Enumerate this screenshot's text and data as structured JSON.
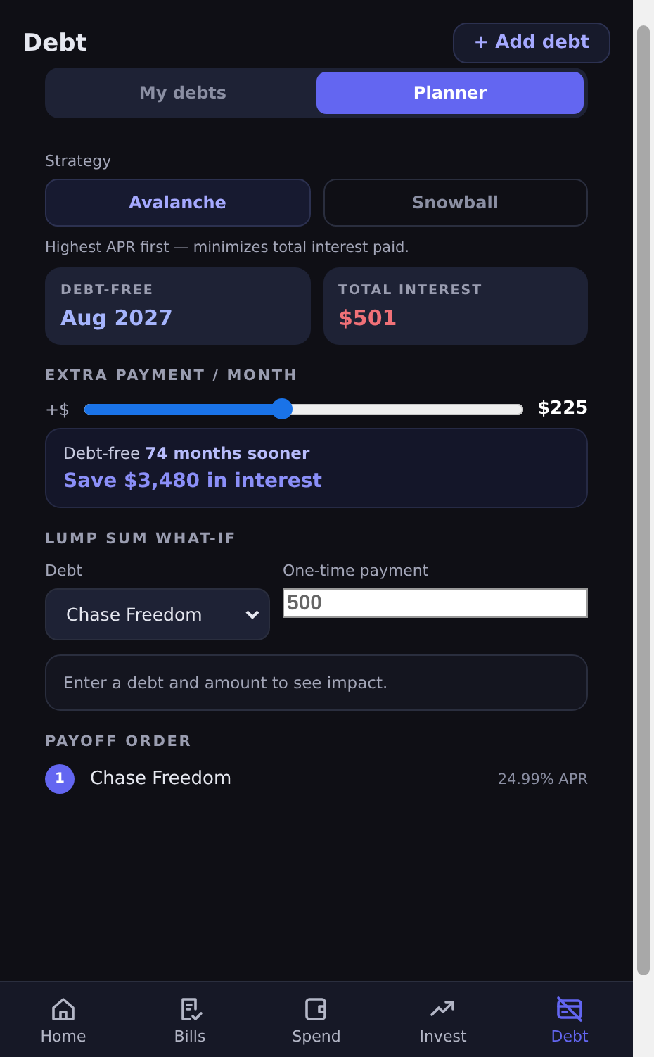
{
  "header": {
    "title": "Debt",
    "add_button": "+ Add debt"
  },
  "view_tabs": [
    {
      "label": "My debts",
      "selected": false
    },
    {
      "label": "Planner",
      "selected": true
    }
  ],
  "strategy": {
    "label": "Strategy",
    "options": [
      {
        "label": "Avalanche",
        "selected": true
      },
      {
        "label": "Snowball",
        "selected": false
      }
    ],
    "description": "Highest APR first — minimizes total interest paid."
  },
  "stats": [
    {
      "label": "DEBT-FREE",
      "value": "Aug 2027",
      "kind": "accent"
    },
    {
      "label": "TOTAL INTEREST",
      "value": "$501",
      "kind": "negative"
    }
  ],
  "extra_payment": {
    "heading": "EXTRA PAYMENT / MONTH",
    "prefix": "+$",
    "level": 0.45,
    "reading": "$225"
  },
  "impact": {
    "line": "Debt-free **74 months sooner**",
    "savings": "Save $3,480 in interest"
  },
  "lump_sum": {
    "heading": "LUMP SUM WHAT-IF",
    "debt_label": "Debt",
    "debt_value": "Chase Freedom",
    "payment_label": "One-time payment",
    "payment_value": "500",
    "result": "Enter a debt and amount to see impact."
  },
  "payoff": {
    "heading": "PAYOFF ORDER",
    "items": [
      {
        "rank": "1",
        "name": "Chase Freedom",
        "apr": "24.99% APR"
      }
    ]
  },
  "nav": [
    {
      "label": "Home",
      "kind": "home",
      "selected": false
    },
    {
      "label": "Bills",
      "kind": "bills",
      "selected": false
    },
    {
      "label": "Spend",
      "kind": "wallet",
      "selected": false
    },
    {
      "label": "Invest",
      "kind": "trend",
      "selected": false
    },
    {
      "label": "Debt",
      "kind": "card",
      "selected": true
    }
  ]
}
